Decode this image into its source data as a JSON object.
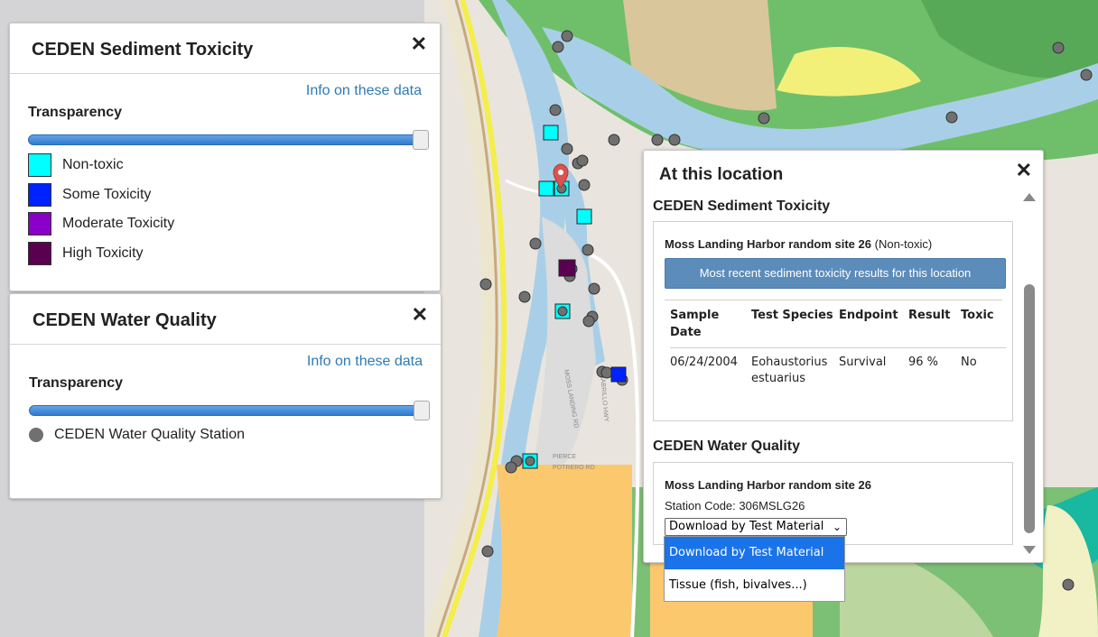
{
  "sediment_panel": {
    "title": "CEDEN Sediment Toxicity",
    "info_link": "Info on these data",
    "transparency_label": "Transparency",
    "transparency_value": 1.0,
    "legend": [
      {
        "label": "Non-toxic",
        "color": "#00ffff"
      },
      {
        "label": "Some Toxicity",
        "color": "#0022ff"
      },
      {
        "label": "Moderate Toxicity",
        "color": "#8a00c8"
      },
      {
        "label": "High Toxicity",
        "color": "#5a0050"
      }
    ]
  },
  "water_panel": {
    "title": "CEDEN Water Quality",
    "info_link": "Info on these data",
    "transparency_label": "Transparency",
    "transparency_value": 1.0,
    "legend": [
      {
        "label": "CEDEN Water Quality Station",
        "color": "#707070"
      }
    ]
  },
  "popup": {
    "title": "At this location",
    "sediment": {
      "section": "CEDEN Sediment Toxicity",
      "site_name": "Moss Landing Harbor random site 26",
      "site_status": "(Non-toxic)",
      "button": "Most recent sediment toxicity results for this location",
      "headers": [
        "Sample Date",
        "Test Species",
        "Endpoint",
        "Result",
        "Toxic"
      ],
      "rows": [
        [
          "06/24/2004",
          "Eohaustorius estuarius",
          "Survival",
          "96 %",
          "No"
        ]
      ]
    },
    "water": {
      "section": "CEDEN Water Quality",
      "site_name": "Moss Landing Harbor random site 26",
      "station_code": "Station Code: 306MSLG26",
      "select_value": "Download by Test Material",
      "options": [
        "Download by Test Material",
        "Tissue (fish, bivalves...)"
      ]
    }
  },
  "map": {
    "road_labels": [
      "MOSS LANDING RD",
      "CABRILLO HWY",
      "PIERCE",
      "POTRERO RD"
    ]
  }
}
